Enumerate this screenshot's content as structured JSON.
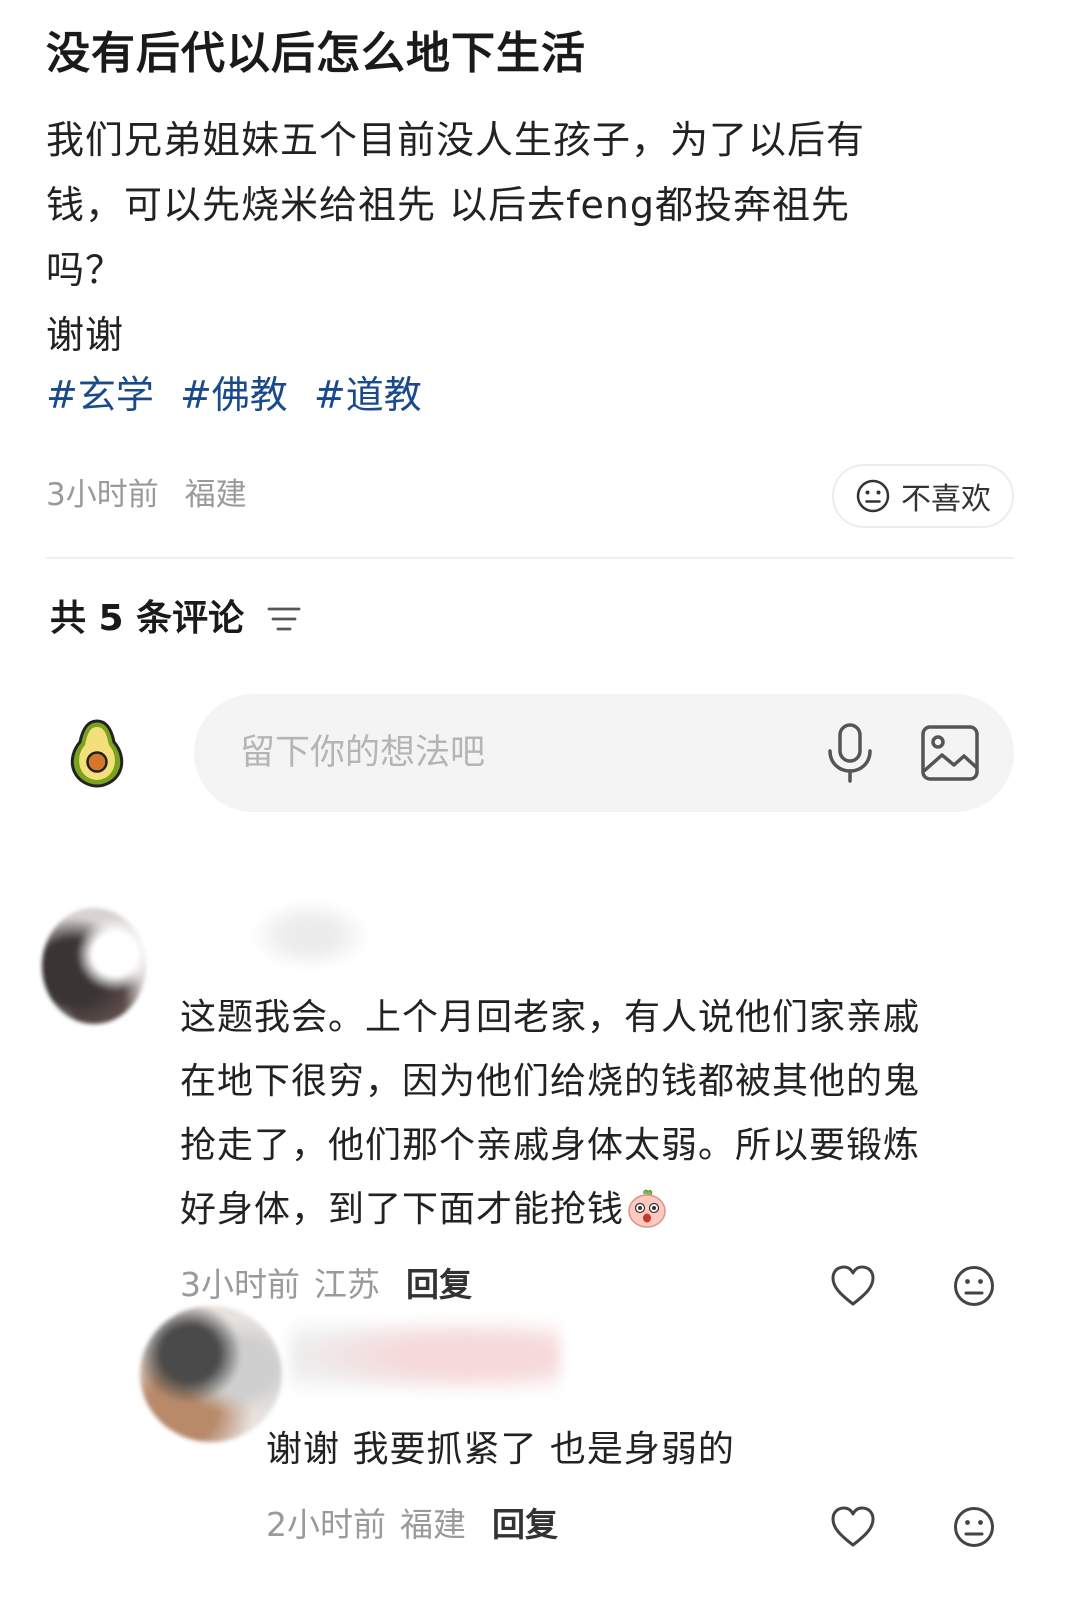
{
  "post": {
    "title": "没有后代以后怎么地下生活",
    "body_lines": [
      "我们兄弟姐妹五个目前没人生孩子，为了以后有",
      "钱，可以先烧米给祖先 以后去feng都投奔祖先",
      "吗？",
      "谢谢"
    ],
    "tags": [
      "#玄学",
      "#佛教",
      "#道教"
    ],
    "time": "3小时前",
    "location": "福建",
    "dislike_label": "不喜欢"
  },
  "comments_header": {
    "title": "共 5 条评论",
    "sort_icon": "filter-lines-icon"
  },
  "comment_input": {
    "placeholder": "留下你的想法吧",
    "avatar_icon": "avocado-icon",
    "mic_icon": "mic-icon",
    "image_icon": "image-icon"
  },
  "comments": [
    {
      "text_lines": [
        "这题我会。上个月回老家，有人说他们家亲戚",
        "在地下很穷，因为他们给烧的钱都被其他的鬼",
        "抢走了，他们那个亲戚身体太弱。所以要锻炼",
        "好身体，到了下面才能抢钱"
      ],
      "emoji": "shocked-face-emoji",
      "time": "3小时前",
      "location": "江苏",
      "reply_label": "回复"
    },
    {
      "text": "谢谢 我要抓紧了 也是身弱的",
      "time": "2小时前",
      "location": "福建",
      "reply_label": "回复"
    }
  ],
  "colors": {
    "tag": "#1b4a8c",
    "meta": "#9a9a9a",
    "input_bg": "#f4f4f4",
    "divider": "#efefef"
  }
}
